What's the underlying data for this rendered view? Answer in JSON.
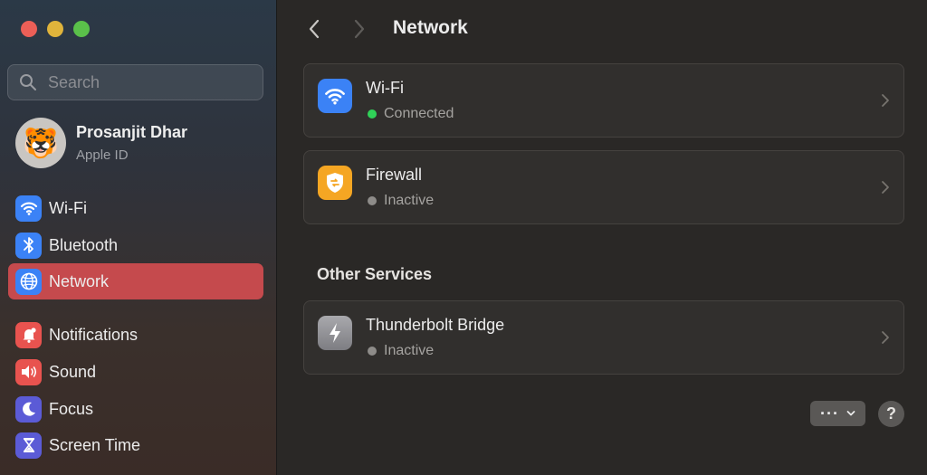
{
  "window": {
    "controls": [
      "close",
      "minimize",
      "zoom"
    ]
  },
  "sidebar": {
    "search": {
      "placeholder": "Search",
      "value": ""
    },
    "account": {
      "name": "Prosanjit Dhar",
      "subtitle": "Apple ID",
      "avatar_emoji": "🐯"
    },
    "items": [
      {
        "label": "Wi-Fi",
        "icon": "wifi-icon",
        "color": "#3b82f6",
        "active": false
      },
      {
        "label": "Bluetooth",
        "icon": "bluetooth-icon",
        "color": "#3b82f6",
        "active": false
      },
      {
        "label": "Network",
        "icon": "globe-icon",
        "color": "#3b82f6",
        "active": true
      },
      {
        "label": "Notifications",
        "icon": "bell-icon",
        "color": "#e8534f",
        "active": false
      },
      {
        "label": "Sound",
        "icon": "speaker-icon",
        "color": "#e8534f",
        "active": false
      },
      {
        "label": "Focus",
        "icon": "moon-icon",
        "color": "#5b5bd6",
        "active": false
      },
      {
        "label": "Screen Time",
        "icon": "hourglass-icon",
        "color": "#5b5bd6",
        "active": false
      }
    ]
  },
  "main": {
    "title": "Network",
    "services": [
      {
        "title": "Wi-Fi",
        "status": "Connected",
        "status_color": "#30d158",
        "icon": "wifi-icon",
        "icon_color": "#3b82f6"
      },
      {
        "title": "Firewall",
        "status": "Inactive",
        "status_color": "#8e8c89",
        "icon": "firewall-shield-icon",
        "icon_color": "#f5a623"
      }
    ],
    "other_services_title": "Other Services",
    "other_services": [
      {
        "title": "Thunderbolt Bridge",
        "status": "Inactive",
        "status_color": "#8e8c89",
        "icon": "thunderbolt-icon",
        "icon_color": "#8e8e93"
      }
    ],
    "footer": {
      "more_label": "···",
      "help_label": "?"
    }
  },
  "colors": {
    "accent_active": "#c54a4d",
    "connected": "#30d158",
    "inactive": "#8e8c89"
  }
}
